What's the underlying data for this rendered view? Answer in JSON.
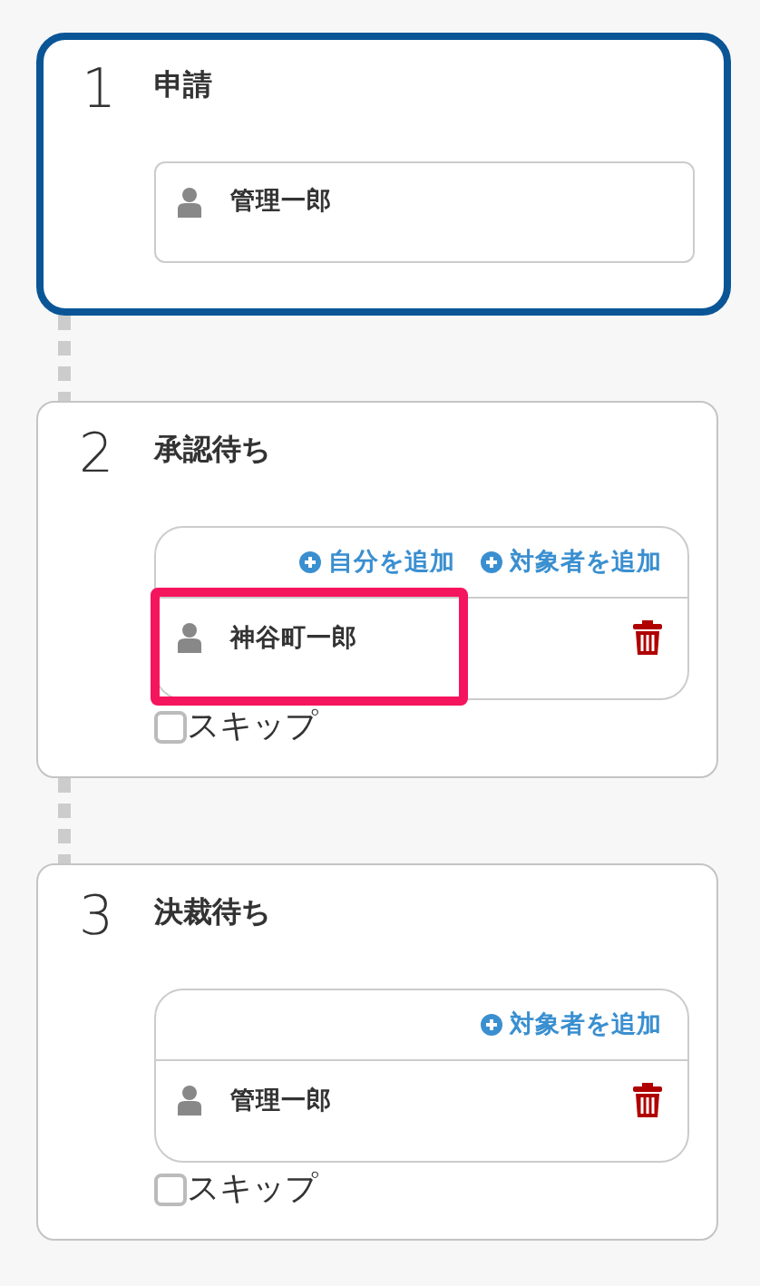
{
  "steps": [
    {
      "number": "1",
      "title": "申請",
      "selected": true,
      "members": [
        {
          "name": "管理一郎",
          "highlighted": false,
          "removable": false
        }
      ]
    },
    {
      "number": "2",
      "title": "承認待ち",
      "selected": false,
      "actions": [
        "自分を追加",
        "対象者を追加"
      ],
      "members": [
        {
          "name": "神谷町一郎",
          "highlighted": true,
          "removable": true
        }
      ],
      "skip": {
        "label": "スキップ",
        "checked": false
      }
    },
    {
      "number": "3",
      "title": "決裁待ち",
      "selected": false,
      "actions": [
        "対象者を追加"
      ],
      "members": [
        {
          "name": "管理一郎",
          "highlighted": false,
          "removable": true
        }
      ],
      "skip": {
        "label": "スキップ",
        "checked": false
      }
    }
  ]
}
